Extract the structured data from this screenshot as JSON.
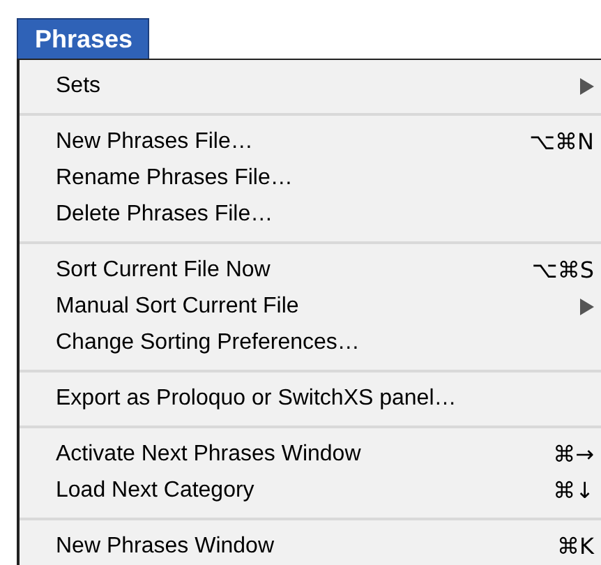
{
  "menu_title": "Phrases",
  "groups": [
    [
      {
        "label": "Sets",
        "has_submenu": true
      }
    ],
    [
      {
        "label": "New Phrases File…",
        "shortcut": "⌥⌘N",
        "has_submenu": false
      },
      {
        "label": "Rename Phrases File…",
        "has_submenu": false
      },
      {
        "label": "Delete Phrases File…",
        "has_submenu": false
      }
    ],
    [
      {
        "label": "Sort Current File Now",
        "shortcut": "⌥⌘S",
        "has_submenu": false
      },
      {
        "label": "Manual Sort Current File",
        "has_submenu": true
      },
      {
        "label": "Change Sorting Preferences…",
        "has_submenu": false
      }
    ],
    [
      {
        "label": "Export as Proloquo or SwitchXS panel…",
        "has_submenu": false
      }
    ],
    [
      {
        "label": "Activate Next Phrases Window",
        "shortcut": "⌘→",
        "has_submenu": false
      },
      {
        "label": "Load Next Category",
        "shortcut": "⌘↓",
        "has_submenu": false
      }
    ],
    [
      {
        "label": "New Phrases Window",
        "shortcut": "⌘K",
        "has_submenu": false
      }
    ]
  ]
}
